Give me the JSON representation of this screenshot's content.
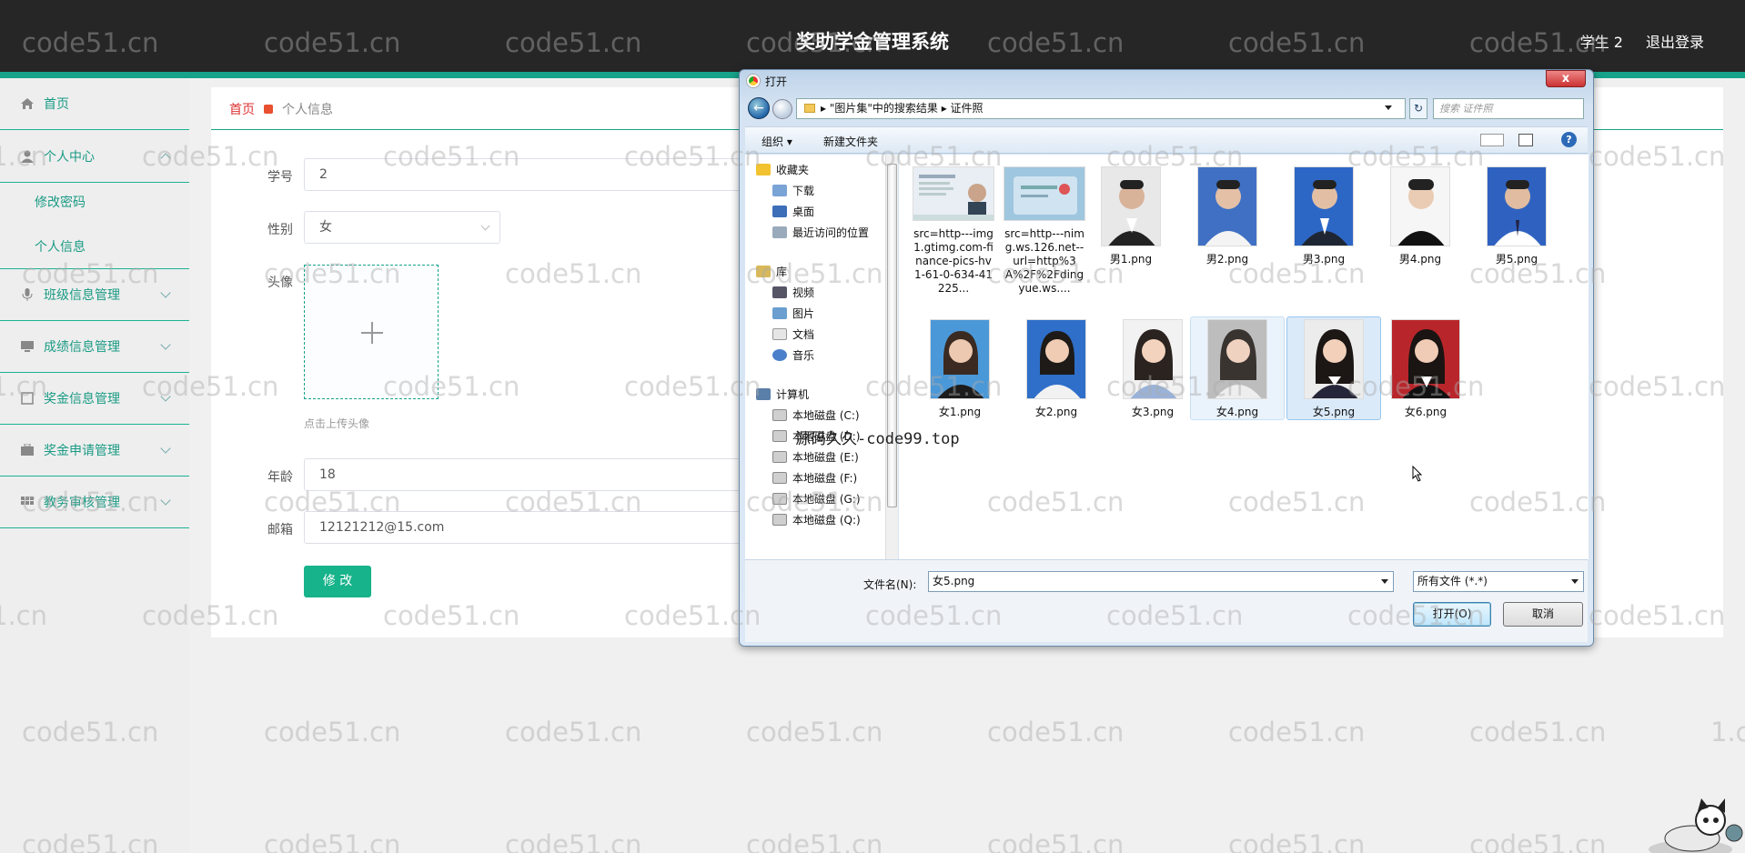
{
  "header": {
    "title": "奖助学金管理系统",
    "user": "学生 2",
    "logout": "退出登录"
  },
  "sidebar": {
    "home": "首页",
    "personal_center": "个人中心",
    "change_password": "修改密码",
    "personal_info": "个人信息",
    "class_mgmt": "班级信息管理",
    "score_mgmt": "成绩信息管理",
    "award_mgmt": "奖金信息管理",
    "apply_mgmt": "奖金申请管理",
    "review_mgmt": "教务审核管理"
  },
  "breadcrumb": {
    "home": "首页",
    "current": "个人信息"
  },
  "form": {
    "student_no_label": "学号",
    "student_no": "2",
    "gender_label": "性别",
    "gender": "女",
    "avatar_label": "头像",
    "upload_tip": "点击上传头像",
    "age_label": "年龄",
    "age": "18",
    "email_label": "邮箱",
    "email": "12121212@15.com",
    "submit": "修 改"
  },
  "watermark": "code51.cn",
  "watermark_partial": "1.cn",
  "overlay_text": "源码久久-code99.top",
  "dialog": {
    "title": "打开",
    "close": "x",
    "path": [
      "\"图片集\"中的搜索结果",
      "证件照"
    ],
    "search_placeholder": "搜索 证件照",
    "toolbar": {
      "organize": "组织 ▾",
      "new_folder": "新建文件夹"
    },
    "nav": {
      "favorites": "收藏夹",
      "downloads": "下载",
      "desktop": "桌面",
      "recent": "最近访问的位置",
      "libraries": "库",
      "videos": "视频",
      "pictures": "图片",
      "documents": "文档",
      "music": "音乐",
      "computer": "计算机",
      "drives": [
        "本地磁盘 (C:)",
        "本地磁盘 (D:)",
        "本地磁盘 (E:)",
        "本地磁盘 (F:)",
        "本地磁盘 (G:)",
        "本地磁盘 (Q:)"
      ]
    },
    "files": [
      "src=http---img1.gtimg.com-finance-pics-hv1-61-0-634-41225...",
      "src=http---nimg.ws.126.net--url=http%3A%2F%2Fdingyue.ws....",
      "男1.png",
      "男2.png",
      "男3.png",
      "男4.png",
      "男5.png",
      "女1.png",
      "女2.png",
      "女3.png",
      "女4.png",
      "女5.png",
      "女6.png"
    ],
    "filename_label": "文件名(N):",
    "filename_value": "女5.png",
    "filetype": "所有文件 (*.*)",
    "open": "打开(O)",
    "cancel": "取消"
  },
  "colors": {
    "accent": "#17a38a",
    "header_bg": "#262626",
    "primary_button": "#17b38a",
    "crumb_home": "#dd3333"
  }
}
